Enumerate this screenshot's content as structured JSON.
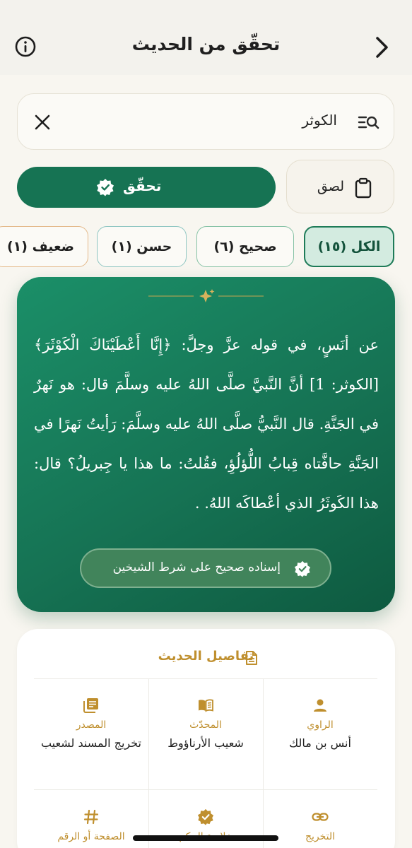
{
  "header": {
    "title": "تحقّق من الحديث",
    "back_icon": "chevron-right-icon",
    "info_icon": "info-icon"
  },
  "search": {
    "value": "الكوثر",
    "search_icon": "search-list-icon",
    "clear_icon": "close-icon"
  },
  "actions": {
    "paste_label": "لصق",
    "verify_label": "تحقّق"
  },
  "filters": [
    {
      "label": "الكل (١٥)",
      "selected": true
    },
    {
      "label": "صحيح (٦)",
      "selected": false
    },
    {
      "label": "حسن (١)",
      "selected": false
    },
    {
      "label": "ضعيف (١)",
      "selected": false
    }
  ],
  "hadith": {
    "text": "عن أنَسٍ، في قوله عزَّ وجلَّ: ﴿إِنَّا أَعْطَيْنَاكَ الْكَوْثَرَ﴾ [الكوثر: 1] أنَّ النَّبيَّ صلَّى اللهُ عليه وسلَّمَ قال: هو نَهرٌ في الجَنَّةِ. قال النَّبيُّ صلَّى اللهُ عليه وسلَّمَ: رَأيتُ نَهرًا في الجَنَّةِ حافَّتاه قِبابُ اللُّؤلُؤِ، فقُلتُ: ما هذا يا جِبريلُ؟ قال: هذا الكَوثَرُ الذي أعْطاكَه اللهُ. .",
    "grade": "إسناده صحيح على شرط الشيخين"
  },
  "details": {
    "title": "تفاصيل الحديث",
    "cells": [
      {
        "icon": "person-icon",
        "label": "الراوي",
        "value": "أنس بن مالك"
      },
      {
        "icon": "open-book-icon",
        "label": "المحدّث",
        "value": "شعيب الأرناؤوط"
      },
      {
        "icon": "library-books-icon",
        "label": "المصدر",
        "value": "تخريج المسند لشعيب"
      },
      {
        "icon": "link-icon",
        "label": "التخريج",
        "value": ""
      },
      {
        "icon": "verified-badge-icon",
        "label": "خلاصة الحكم",
        "value": ""
      },
      {
        "icon": "hash-icon",
        "label": "الصفحة أو الرقم",
        "value": ""
      }
    ]
  },
  "colors": {
    "primary_green": "#167353",
    "gold": "#bf8f2e",
    "background": "#f8f6f0"
  }
}
